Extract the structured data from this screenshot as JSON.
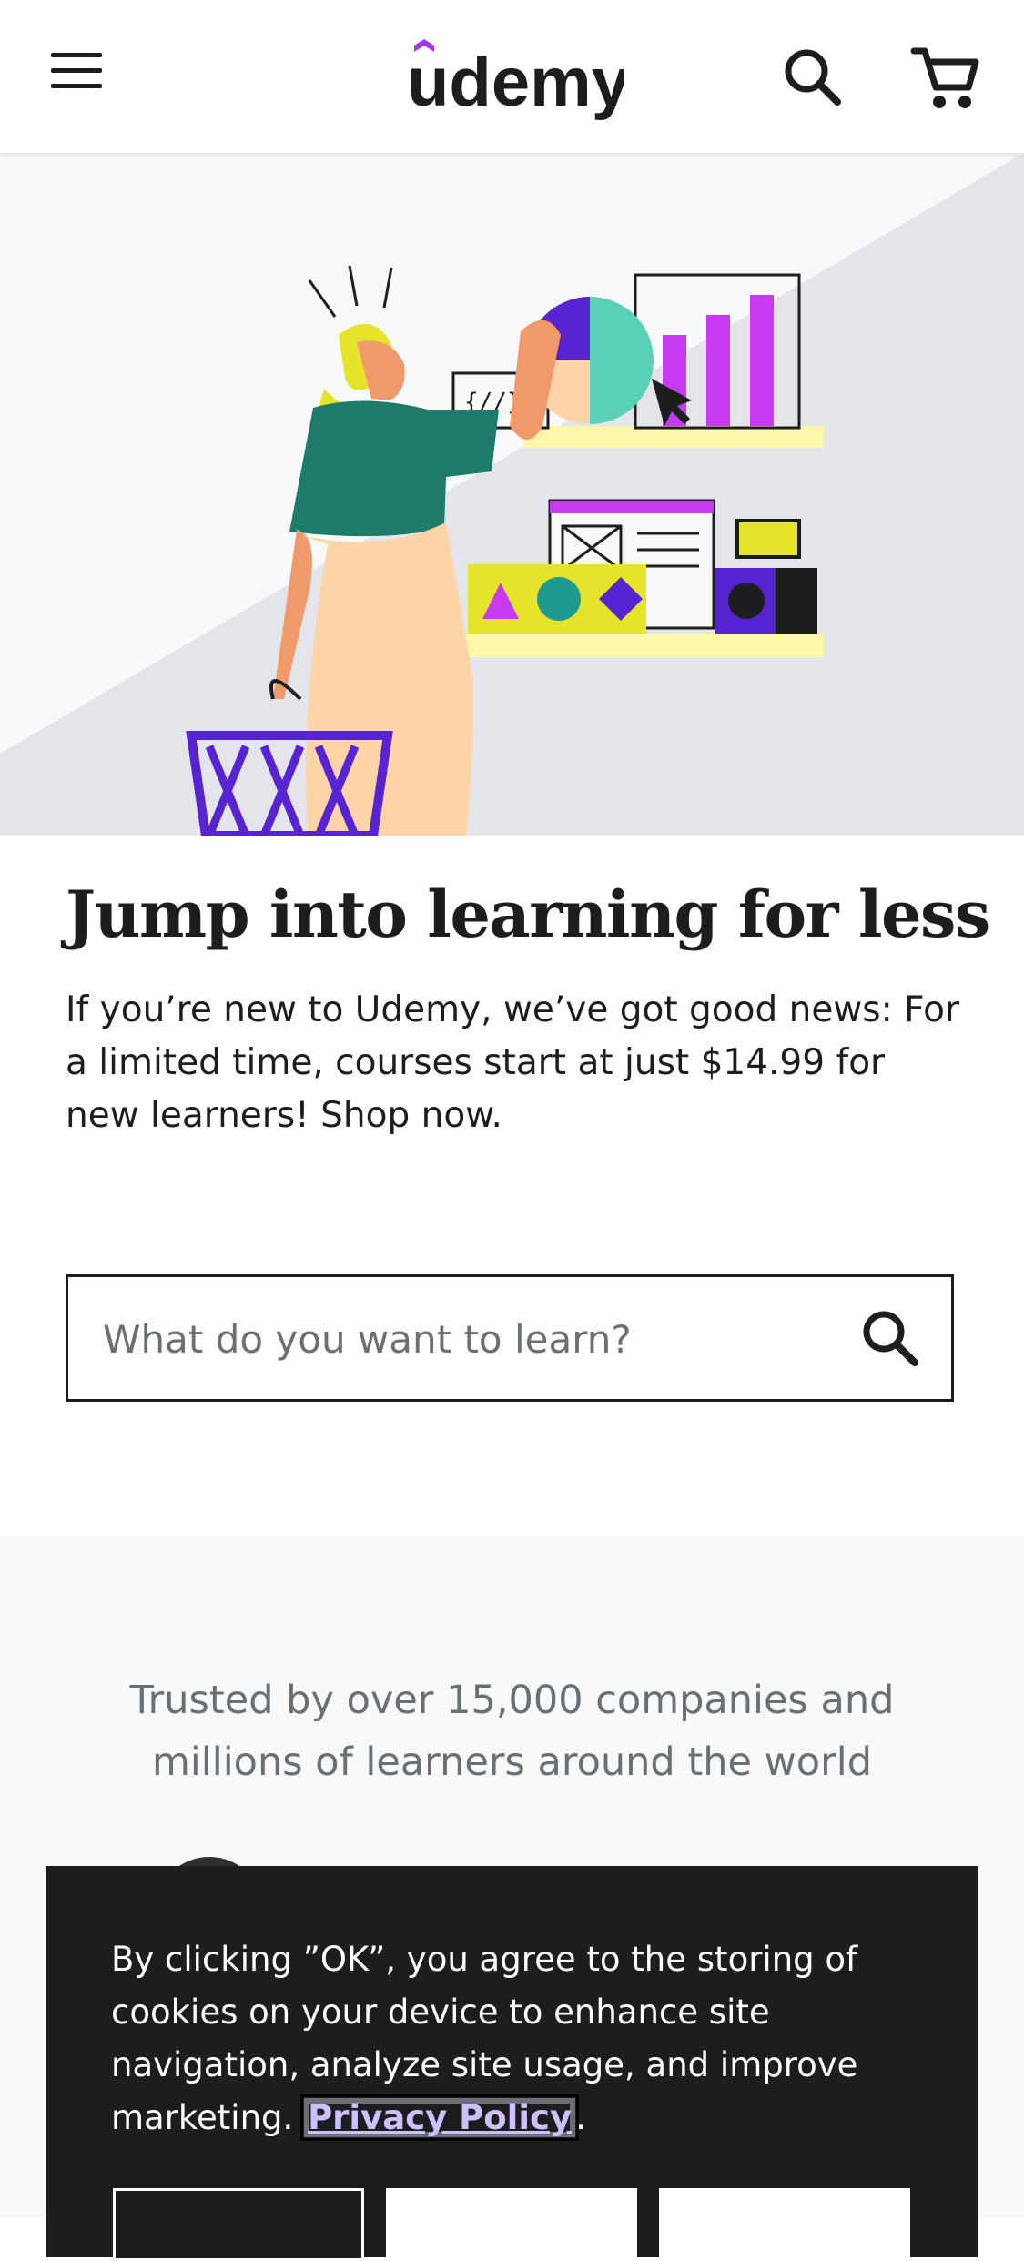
{
  "header": {
    "logo_text": "udemy",
    "menu_icon": "hamburger-menu-icon",
    "search_icon": "search-icon",
    "cart_icon": "shopping-cart-icon"
  },
  "hero": {
    "headline": "Jump into learning for less",
    "subtext": "If you’re new to Udemy, we’ve got good news: For a limited time, courses start at just $14.99 for new learners! Shop now."
  },
  "search": {
    "placeholder": "What do you want to learn?",
    "submit_icon": "search-icon"
  },
  "trusted": {
    "text": "Trusted by over 15,000 companies and millions of learners around the world"
  },
  "cookie_banner": {
    "text": "By clicking ”OK”, you agree to the storing of cookies on your device to enhance site navigation, analyze site usage, and improve marketing.",
    "privacy_link": "Privacy Policy",
    "suffix": "."
  },
  "colors": {
    "brand_purple": "#a435f0",
    "text_dark": "#1c1d1f",
    "text_muted": "#6a6f73",
    "banner_bg": "#1c1d1f",
    "link_purple": "#cec0fc"
  }
}
